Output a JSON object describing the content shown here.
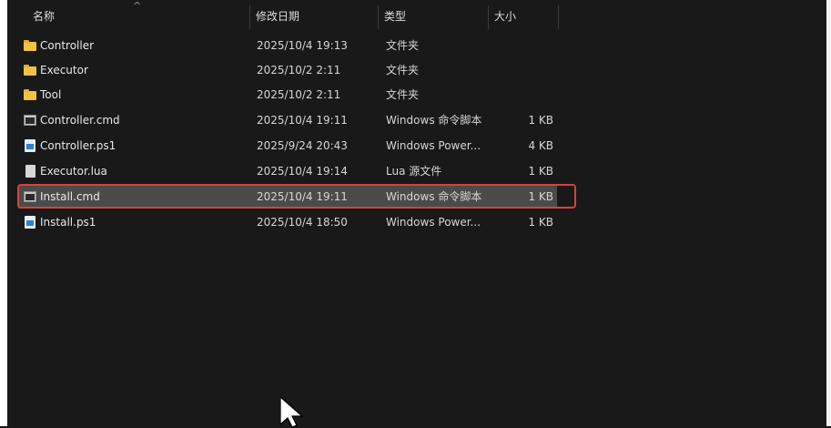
{
  "columns": {
    "name": "名称",
    "date": "修改日期",
    "type": "类型",
    "size": "大小"
  },
  "files": [
    {
      "icon": "folder-icon",
      "name": "Controller",
      "date": "2025/10/4 19:13",
      "type": "文件夹",
      "size": ""
    },
    {
      "icon": "folder-icon",
      "name": "Executor",
      "date": "2025/10/2 2:11",
      "type": "文件夹",
      "size": ""
    },
    {
      "icon": "folder-icon",
      "name": "Tool",
      "date": "2025/10/2 2:11",
      "type": "文件夹",
      "size": ""
    },
    {
      "icon": "cmd-file-icon",
      "name": "Controller.cmd",
      "date": "2025/10/4 19:11",
      "type": "Windows 命令脚本",
      "size": "1 KB"
    },
    {
      "icon": "powershell-file-icon",
      "name": "Controller.ps1",
      "date": "2025/9/24 20:43",
      "type": "Windows Power...",
      "size": "4 KB"
    },
    {
      "icon": "lua-file-icon",
      "name": "Executor.lua",
      "date": "2025/10/4 19:14",
      "type": "Lua 源文件",
      "size": "1 KB"
    },
    {
      "icon": "cmd-file-icon",
      "name": "Install.cmd",
      "date": "2025/10/4 19:11",
      "type": "Windows 命令脚本",
      "size": "1 KB",
      "selected": true
    },
    {
      "icon": "powershell-file-icon",
      "name": "Install.ps1",
      "date": "2025/10/4 18:50",
      "type": "Windows Power...",
      "size": "1 KB"
    }
  ],
  "colors": {
    "background": "#191919",
    "selection": "#4b4b4b",
    "highlight_border": "#d9413d"
  }
}
